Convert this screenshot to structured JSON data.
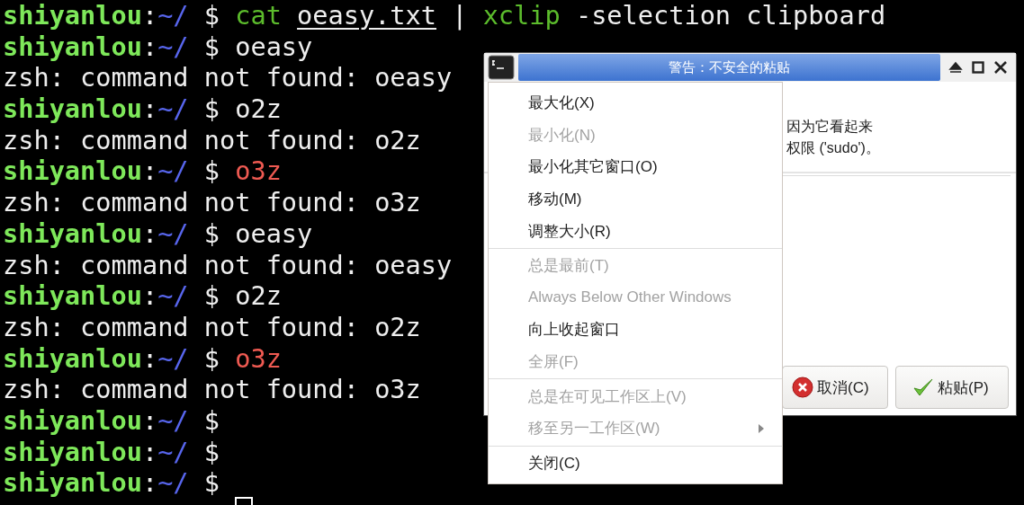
{
  "terminal": {
    "cursor_visible": true,
    "lines": [
      {
        "kind": "prompt",
        "user": "shiyanlou",
        "separator": ":",
        "path": "~/",
        "symbol": "$",
        "command": [
          {
            "text": "cat",
            "kind": "builtin"
          },
          {
            "text": "oeasy.txt",
            "kind": "file"
          },
          {
            "text": "|",
            "kind": "plain"
          },
          {
            "text": "xclip",
            "kind": "builtin"
          },
          {
            "text": "-selection clipboard",
            "kind": "plain"
          }
        ]
      },
      {
        "kind": "prompt",
        "user": "shiyanlou",
        "separator": ":",
        "path": "~/",
        "symbol": "$",
        "command": [
          {
            "text": "oeasy",
            "kind": "plain"
          }
        ]
      },
      {
        "kind": "output",
        "text": "zsh: command not found: oeasy"
      },
      {
        "kind": "prompt",
        "user": "shiyanlou",
        "separator": ":",
        "path": "~/",
        "symbol": "$",
        "command": [
          {
            "text": "o2z",
            "kind": "plain"
          }
        ]
      },
      {
        "kind": "output",
        "text": "zsh: command not found: o2z"
      },
      {
        "kind": "prompt",
        "user": "shiyanlou",
        "separator": ":",
        "path": "~/",
        "symbol": "$",
        "command": [
          {
            "text": "o3z",
            "kind": "error"
          }
        ]
      },
      {
        "kind": "output",
        "text": "zsh: command not found: o3z"
      },
      {
        "kind": "prompt",
        "user": "shiyanlou",
        "separator": ":",
        "path": "~/",
        "symbol": "$",
        "command": [
          {
            "text": "oeasy",
            "kind": "plain"
          }
        ]
      },
      {
        "kind": "output",
        "text": "zsh: command not found: oeasy"
      },
      {
        "kind": "prompt",
        "user": "shiyanlou",
        "separator": ":",
        "path": "~/",
        "symbol": "$",
        "command": [
          {
            "text": "o2z",
            "kind": "plain"
          }
        ]
      },
      {
        "kind": "output",
        "text": "zsh: command not found: o2z"
      },
      {
        "kind": "prompt",
        "user": "shiyanlou",
        "separator": ":",
        "path": "~/",
        "symbol": "$",
        "command": [
          {
            "text": "o3z",
            "kind": "error"
          }
        ]
      },
      {
        "kind": "output",
        "text": "zsh: command not found: o3z"
      },
      {
        "kind": "prompt",
        "user": "shiyanlou",
        "separator": ":",
        "path": "~/",
        "symbol": "$"
      },
      {
        "kind": "prompt",
        "user": "shiyanlou",
        "separator": ":",
        "path": "~/",
        "symbol": "$"
      },
      {
        "kind": "prompt",
        "user": "shiyanlou",
        "separator": ":",
        "path": "~/",
        "symbol": "$"
      }
    ]
  },
  "dialog": {
    "title": "警告：不安全的粘贴",
    "message_lines": [
      "因为它看起来",
      "权限 ('sudo')。"
    ],
    "buttons": [
      {
        "label": "取消(C)",
        "kind": "cancel"
      },
      {
        "label": "粘贴(P)",
        "kind": "ok"
      }
    ]
  },
  "window_menu": {
    "items": [
      {
        "kind": "item",
        "label": "最大化(X)",
        "disabled": false,
        "submenu": false
      },
      {
        "kind": "item",
        "label": "最小化(N)",
        "disabled": true,
        "submenu": false
      },
      {
        "kind": "item",
        "label": "最小化其它窗口(O)",
        "disabled": false,
        "submenu": false
      },
      {
        "kind": "item",
        "label": "移动(M)",
        "disabled": false,
        "submenu": false
      },
      {
        "kind": "item",
        "label": "调整大小(R)",
        "disabled": false,
        "submenu": false
      },
      {
        "kind": "separator"
      },
      {
        "kind": "item",
        "label": "总是最前(T)",
        "disabled": true,
        "submenu": false
      },
      {
        "kind": "item",
        "label": "Always Below Other Windows",
        "disabled": true,
        "submenu": false
      },
      {
        "kind": "item",
        "label": "向上收起窗口",
        "disabled": false,
        "submenu": false
      },
      {
        "kind": "item",
        "label": "全屏(F)",
        "disabled": true,
        "submenu": false
      },
      {
        "kind": "separator"
      },
      {
        "kind": "item",
        "label": "总是在可见工作区上(V)",
        "disabled": true,
        "submenu": false
      },
      {
        "kind": "item",
        "label": "移至另一工作区(W)",
        "disabled": true,
        "submenu": true
      },
      {
        "kind": "separator"
      },
      {
        "kind": "item",
        "label": "关闭(C)",
        "disabled": false,
        "submenu": false
      }
    ]
  }
}
